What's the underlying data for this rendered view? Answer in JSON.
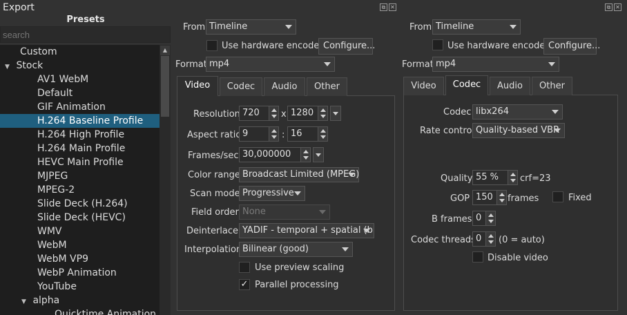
{
  "window": {
    "title": "Export"
  },
  "presets": {
    "header": "Presets",
    "search_placeholder": "search",
    "items": [
      {
        "label": "Custom",
        "indent": 1,
        "arrow": ""
      },
      {
        "label": "Stock",
        "indent": 0,
        "arrow": "▼"
      },
      {
        "label": "AV1 WebM",
        "indent": 2,
        "arrow": ""
      },
      {
        "label": "Default",
        "indent": 2,
        "arrow": ""
      },
      {
        "label": "GIF Animation",
        "indent": 2,
        "arrow": ""
      },
      {
        "label": "H.264 Baseline Profile",
        "indent": 2,
        "arrow": "",
        "selected": true
      },
      {
        "label": "H.264 High Profile",
        "indent": 2,
        "arrow": ""
      },
      {
        "label": "H.264 Main Profile",
        "indent": 2,
        "arrow": ""
      },
      {
        "label": "HEVC Main Profile",
        "indent": 2,
        "arrow": ""
      },
      {
        "label": "MJPEG",
        "indent": 2,
        "arrow": ""
      },
      {
        "label": "MPEG-2",
        "indent": 2,
        "arrow": ""
      },
      {
        "label": "Slide Deck (H.264)",
        "indent": 2,
        "arrow": ""
      },
      {
        "label": "Slide Deck (HEVC)",
        "indent": 2,
        "arrow": ""
      },
      {
        "label": "WMV",
        "indent": 2,
        "arrow": ""
      },
      {
        "label": "WebM",
        "indent": 2,
        "arrow": ""
      },
      {
        "label": "WebM VP9",
        "indent": 2,
        "arrow": ""
      },
      {
        "label": "WebP Animation",
        "indent": 2,
        "arrow": ""
      },
      {
        "label": "YouTube",
        "indent": 2,
        "arrow": ""
      },
      {
        "label": "alpha",
        "indent": 1,
        "arrow": "▼"
      },
      {
        "label": "Quicktime Animation",
        "indent": 3,
        "arrow": ""
      }
    ]
  },
  "left": {
    "from_label": "From",
    "from_value": "Timeline",
    "hw_encoder_label": "Use hardware encoder",
    "configure_label": "Configure...",
    "format_label": "Format",
    "format_value": "mp4",
    "tabs": [
      "Video",
      "Codec",
      "Audio",
      "Other"
    ],
    "active_tab": "Video",
    "video": {
      "resolution_label": "Resolution",
      "res_width": "720",
      "res_x": "x",
      "res_height": "1280",
      "aspect_label": "Aspect ratio",
      "aspect_w": "9",
      "aspect_colon": ":",
      "aspect_h": "16",
      "fps_label": "Frames/sec",
      "fps_value": "30,000000",
      "color_range_label": "Color range",
      "color_range_value": "Broadcast Limited (MPEG)",
      "scan_mode_label": "Scan mode",
      "scan_mode_value": "Progressive",
      "field_order_label": "Field order",
      "field_order_value": "None",
      "deinterlacer_label": "Deinterlacer",
      "deinterlacer_value": "YADIF - temporal + spatial (b",
      "interpolation_label": "Interpolation",
      "interpolation_value": "Bilinear (good)",
      "preview_scaling_label": "Use preview scaling",
      "parallel_label": "Parallel processing",
      "parallel_check": "✓"
    }
  },
  "right": {
    "from_label": "From",
    "from_value": "Timeline",
    "hw_encoder_label": "Use hardware encoder",
    "configure_label": "Configure...",
    "format_label": "Format",
    "format_value": "mp4",
    "tabs": [
      "Video",
      "Codec",
      "Audio",
      "Other"
    ],
    "active_tab": "Codec",
    "codec": {
      "codec_label": "Codec",
      "codec_value": "libx264",
      "rate_control_label": "Rate control",
      "rate_control_value": "Quality-based VBR",
      "quality_label": "Quality",
      "quality_value": "55 %",
      "crf_text": "crf=23",
      "gop_label": "GOP",
      "gop_value": "150",
      "gop_unit": "frames",
      "fixed_label": "Fixed",
      "bframes_label": "B frames",
      "bframes_value": "0",
      "threads_label": "Codec threads",
      "threads_value": "0",
      "threads_hint": "(0 = auto)",
      "disable_video_label": "Disable video"
    }
  }
}
